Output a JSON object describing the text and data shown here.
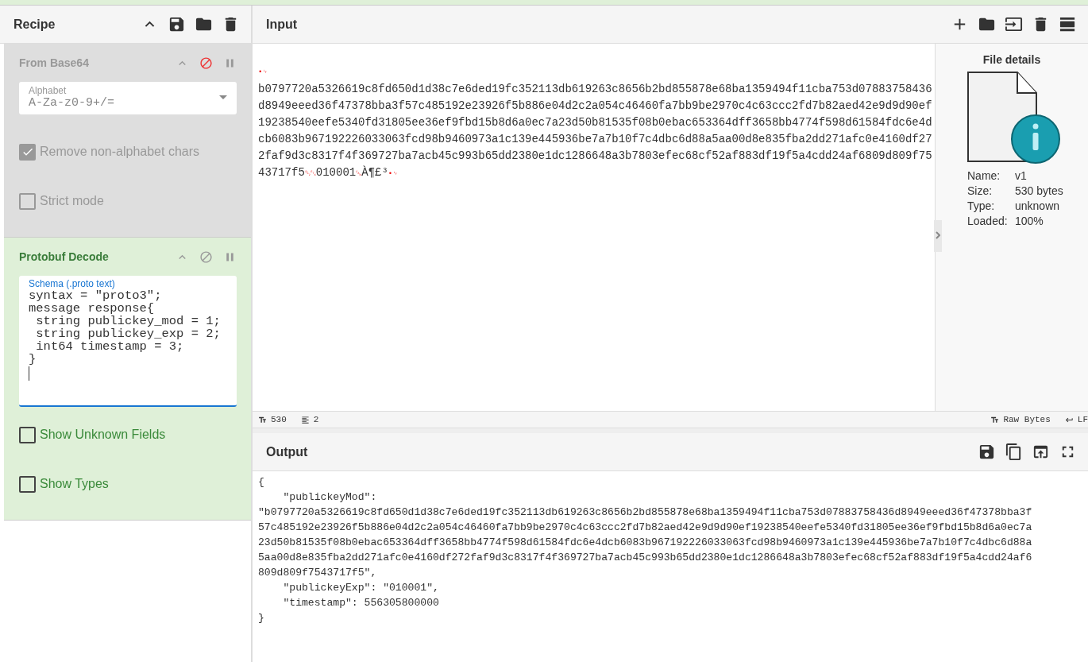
{
  "recipe": {
    "title": "Recipe"
  },
  "operations": [
    {
      "name": "From Base64",
      "disabled": true,
      "args": [
        {
          "kind": "select",
          "label": "Alphabet",
          "value": "A-Za-z0-9+/="
        },
        {
          "kind": "checkbox",
          "label": "Remove non-alphabet chars",
          "checked": true
        },
        {
          "kind": "checkbox",
          "label": "Strict mode",
          "checked": false
        }
      ]
    },
    {
      "name": "Protobuf Decode",
      "disabled": false,
      "args": [
        {
          "kind": "textarea",
          "label": "Schema (.proto text)",
          "lines": [
            "syntax = \"proto3\";",
            "message response{",
            " string publickey_mod = 1;",
            " string publickey_exp = 2;",
            " int64 timestamp = 3;",
            "}"
          ]
        },
        {
          "kind": "checkbox",
          "label": "Show Unknown Fields",
          "checked": false
        },
        {
          "kind": "checkbox",
          "label": "Show Types",
          "checked": false
        }
      ]
    }
  ],
  "input": {
    "title": "Input",
    "lines": [
      [
        {
          "kind": "ctrl",
          "text": "•"
        },
        {
          "kind": "ctrl",
          "text": "␊"
        }
      ],
      [
        {
          "kind": "text",
          "text": "b0797720a5326619c8fd650d1d38c7e6ded19fc352113db619263c8656b2bd855878e68ba1359494f11cba753d07883758436"
        }
      ],
      [
        {
          "kind": "text",
          "text": "d8949eeed36f47378bba3f57c485192e23926f5b886e04d2c2a054c46460fa7bb9be2970c4c63ccc2fd7b82aed42e9d9d90ef"
        }
      ],
      [
        {
          "kind": "text",
          "text": "19238540eefe5340fd31805ee36ef9fbd15b8d6a0ec7a23d50b81535f08b0ebac653364dff3658bb4774f598d61584fdc6e4d"
        }
      ],
      [
        {
          "kind": "text",
          "text": "cb6083b967192226033063fcd98b9460973a1c139e445936be7a7b10f7c4dbc6d88a5aa00d8e835fba2dd271afc0e4160df27"
        }
      ],
      [
        {
          "kind": "text",
          "text": "2faf9d3c8317f4f369727ba7acb45c993b65dd2380e1dc1286648a3b7803efec68cf52af883df19f5a4cdd24af6809d809f75"
        }
      ],
      [
        {
          "kind": "text",
          "text": "43717f5"
        },
        {
          "kind": "ctrl",
          "text": "␒"
        },
        {
          "kind": "ctrl",
          "text": "␃"
        },
        {
          "kind": "text",
          "text": "010001"
        },
        {
          "kind": "ctrl",
          "text": "␘"
        },
        {
          "kind": "text",
          "text": "À¶£³"
        },
        {
          "kind": "ctrl",
          "text": "•"
        },
        {
          "kind": "ctrl",
          "text": "␊"
        }
      ]
    ]
  },
  "file_details": {
    "title": "File details",
    "rows": [
      {
        "label": "Name:",
        "value": "v1"
      },
      {
        "label": "Size:",
        "value": "530 bytes"
      },
      {
        "label": "Type:",
        "value": "unknown"
      },
      {
        "label": "Loaded:",
        "value": "100%"
      }
    ]
  },
  "status": {
    "chars": "530",
    "lines": "2",
    "encoding": "Raw Bytes",
    "eol": "LF"
  },
  "output": {
    "title": "Output",
    "lines": [
      "{",
      "    \"publickeyMod\":",
      "\"b0797720a5326619c8fd650d1d38c7e6ded19fc352113db619263c8656b2bd855878e68ba1359494f11cba753d07883758436d8949eeed36f47378bba3f",
      "57c485192e23926f5b886e04d2c2a054c46460fa7bb9be2970c4c63ccc2fd7b82aed42e9d9d90ef19238540eefe5340fd31805ee36ef9fbd15b8d6a0ec7a",
      "23d50b81535f08b0ebac653364dff3658bb4774f598d61584fdc6e4dcb6083b967192226033063fcd98b9460973a1c139e445936be7a7b10f7c4dbc6d88a",
      "5aa00d8e835fba2dd271afc0e4160df272faf9d3c8317f4f369727ba7acb45c993b65dd2380e1dc1286648a3b7803efec68cf52af883df19f5a4cdd24af6",
      "809d809f7543717f5\",",
      "    \"publickeyExp\": \"010001\",",
      "    \"timestamp\": 556305800000",
      "}"
    ]
  }
}
